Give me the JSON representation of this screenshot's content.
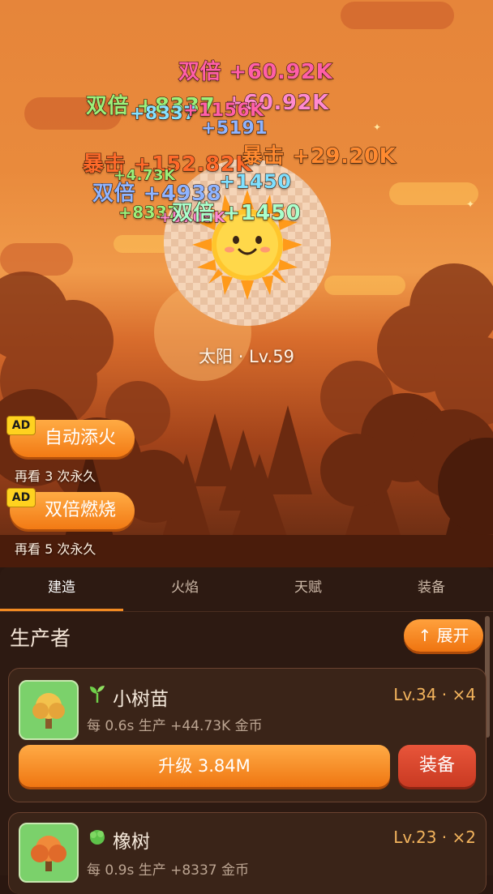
{
  "sun": {
    "label": "太阳 · Lv.59"
  },
  "floating_texts": [
    {
      "text": "双倍 +60.92K",
      "color": "#ff5fa8"
    },
    {
      "text": "双倍 +8337",
      "color": "#9cf07a"
    },
    {
      "text": "+8337",
      "color": "#86e2ff"
    },
    {
      "text": "+1156K",
      "color": "#ff5fa8"
    },
    {
      "text": "+60.92K",
      "color": "#ff8ad0"
    },
    {
      "text": "+5191",
      "color": "#8fb4ff"
    },
    {
      "text": "暴击 +152.82K",
      "color": "#ff6a2a"
    },
    {
      "text": "暴击 +29.20K",
      "color": "#ff8a30"
    },
    {
      "text": "+1450",
      "color": "#7fe0ff"
    },
    {
      "text": "双倍 +4938",
      "color": "#8fb4ff"
    },
    {
      "text": "双倍 +1450",
      "color": "#aaffcc"
    },
    {
      "text": "+8337",
      "color": "#9cf07a"
    },
    {
      "text": "+4.73K",
      "color": "#9cf07a"
    },
    {
      "text": "+5705K",
      "color": "#ff8ad0"
    }
  ],
  "ad_buttons": [
    {
      "ad_tag": "AD",
      "label": "自动添火",
      "sub": "再看 3 次永久"
    },
    {
      "ad_tag": "AD",
      "label": "双倍燃烧",
      "sub": "再看 5 次永久"
    }
  ],
  "tabs": [
    {
      "label": "建造",
      "active": true
    },
    {
      "label": "火焰",
      "active": false
    },
    {
      "label": "天赋",
      "active": false
    },
    {
      "label": "装备",
      "active": false
    }
  ],
  "section": {
    "title": "生产者",
    "expand_label": "↑ 展开"
  },
  "producers": [
    {
      "name": "小树苗",
      "level": "Lv.34 · ×4",
      "desc": "每 0.6s 生产 +44.73K 金币",
      "upgrade_label": "升级 3.84M",
      "equip_label": "装备",
      "icon": "sprout-icon"
    },
    {
      "name": "橡树",
      "level": "Lv.23 · ×2",
      "desc": "每 0.9s 生产 +8337 金币",
      "icon": "bush-icon"
    }
  ],
  "colors": {
    "accent": "#f28a22",
    "panel": "#2d1a12",
    "level": "#f3b45d"
  }
}
